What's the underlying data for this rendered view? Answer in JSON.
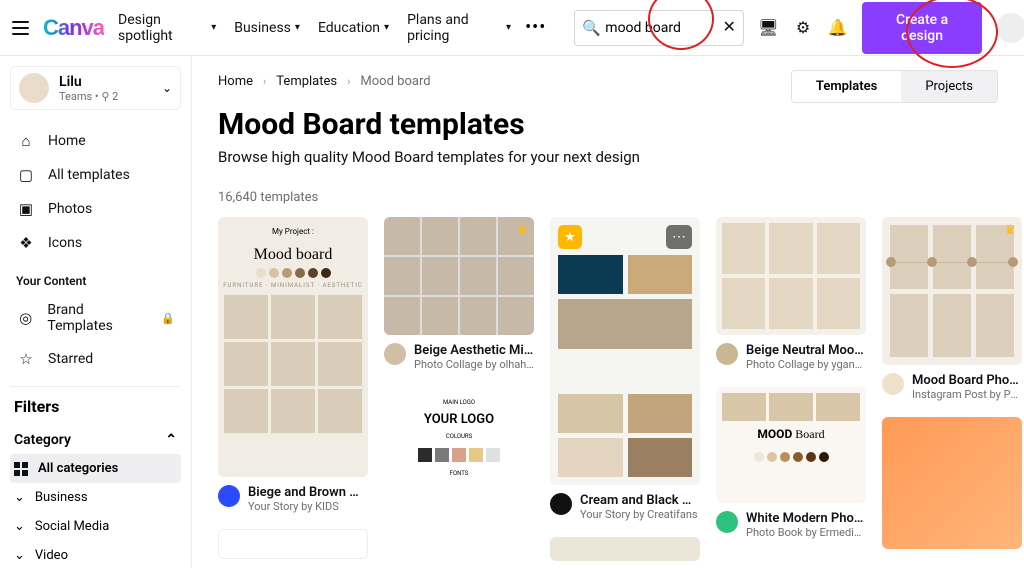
{
  "header": {
    "logo": "Canva",
    "nav": [
      "Design spotlight",
      "Business",
      "Education",
      "Plans and pricing"
    ],
    "search_value": "mood board",
    "cta": "Create a design"
  },
  "profile": {
    "name": "Lilu",
    "team": "Teams  •  ⚲ 2"
  },
  "sidebar": {
    "items": [
      {
        "label": "Home",
        "icon": "⌂"
      },
      {
        "label": "All templates",
        "icon": "▢"
      },
      {
        "label": "Photos",
        "icon": "▣"
      },
      {
        "label": "Icons",
        "icon": "❖"
      }
    ],
    "your_content": "Your Content",
    "content_items": [
      {
        "label": "Brand Templates",
        "icon": "◎",
        "locked": true
      },
      {
        "label": "Starred",
        "icon": "☆"
      }
    ],
    "filters": "Filters",
    "category_label": "Category",
    "categories": [
      "All categories",
      "Business",
      "Social Media",
      "Video"
    ]
  },
  "crumbs": [
    "Home",
    "Templates",
    "Mood board"
  ],
  "tabs": {
    "templates": "Templates",
    "projects": "Projects"
  },
  "page": {
    "title": "Mood Board templates",
    "subtitle": "Browse high quality Mood Board templates for your next design",
    "count": "16,640 templates"
  },
  "cards": {
    "c1": {
      "title": "Biege and Brown Mo…",
      "author": "Your Story by KIDS",
      "thumb_title": "My Project :",
      "thumb_script": "Mood board",
      "thumb_sub": "FURNITURE · MINIMALIST · AESTHETIC"
    },
    "c2": {
      "title": "Beige Aesthetic Mini…",
      "author": "Photo Collage by olhahla…"
    },
    "c3": {
      "title_top": "MAIN LOGO",
      "logo": "YOUR LOGO",
      "colours": "COLOURS",
      "fonts": "FONTS"
    },
    "c4": {
      "title": "Cream and Black Mo…",
      "author": "Your Story by Creatifans"
    },
    "c5": {
      "title": "Beige Neutral Mood …",
      "author": "Photo Collage by yganko"
    },
    "c6": {
      "brand": "MOOD",
      "brand2": "Board",
      "title": "White Modern Photo …",
      "author": "Photo Book by Ermedia S…"
    },
    "c7": {
      "title": "Mood Board Photo C…",
      "author": "Instagram Post by Pure T…"
    }
  },
  "colors": {
    "accent": "#8b3dff"
  }
}
